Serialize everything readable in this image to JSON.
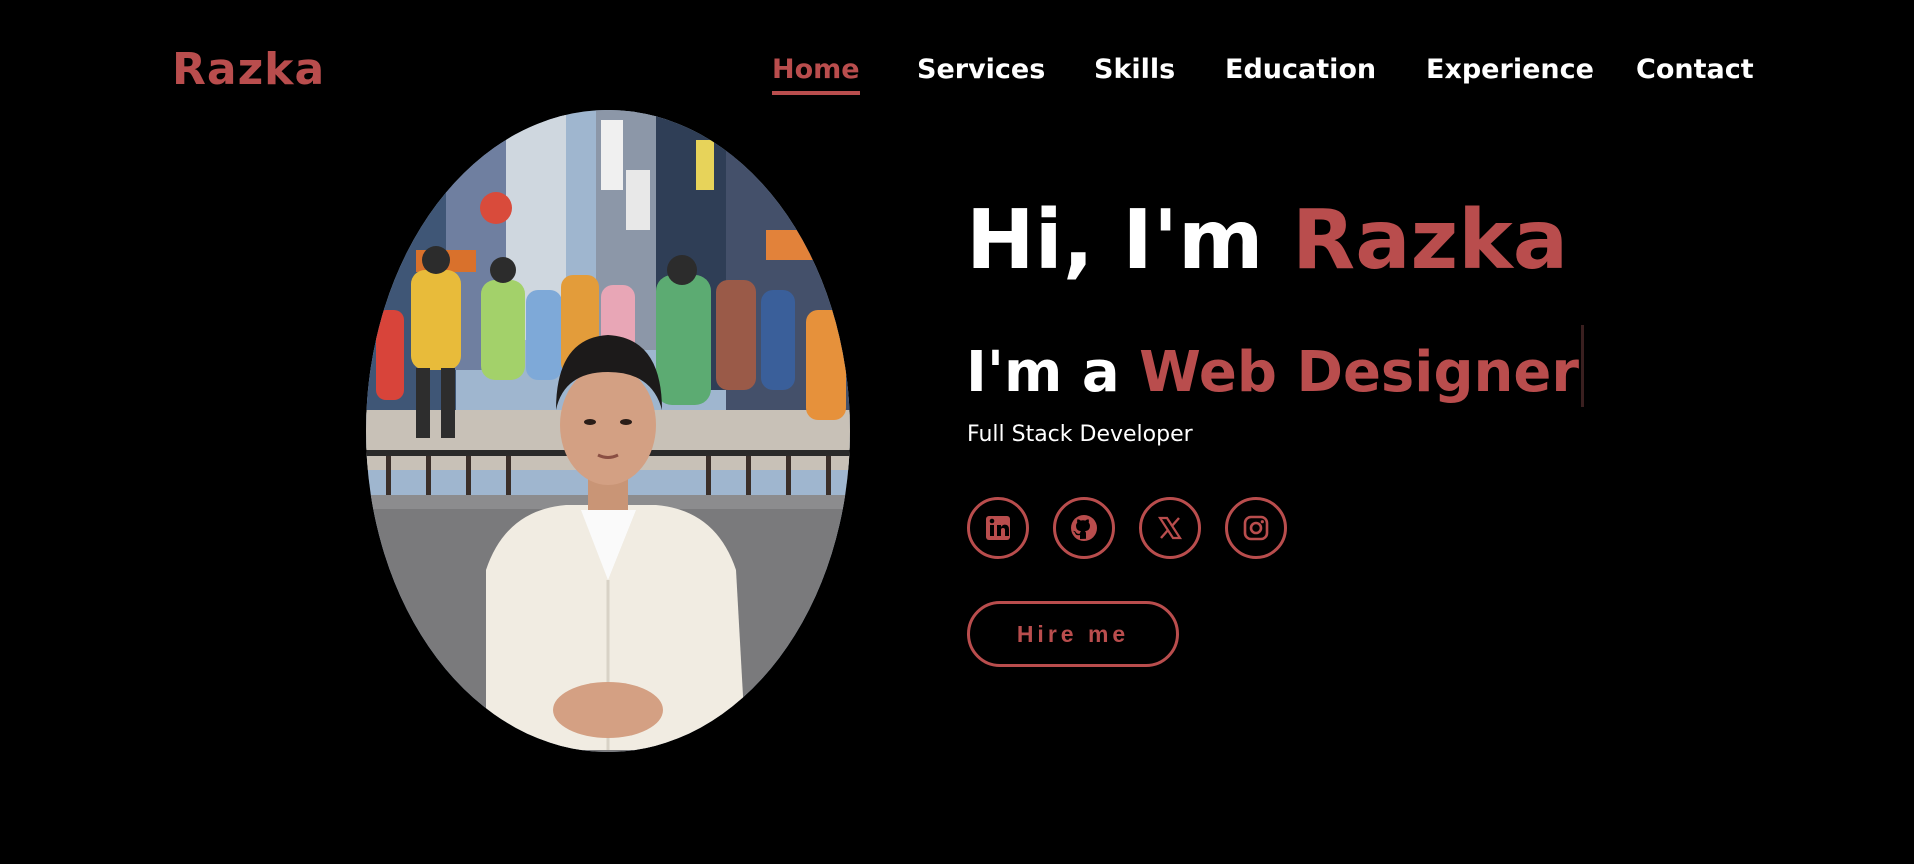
{
  "brand": {
    "name": "Razka",
    "accent_color": "#b94d4d",
    "background": "#000000"
  },
  "nav": {
    "items": [
      {
        "label": "Home",
        "active": true
      },
      {
        "label": "Services",
        "active": false
      },
      {
        "label": "Skills",
        "active": false
      },
      {
        "label": "Education",
        "active": false
      },
      {
        "label": "Experience",
        "active": false
      },
      {
        "label": "Contact",
        "active": false
      }
    ]
  },
  "hero": {
    "greeting": "Hi, I'm ",
    "name": "Razka",
    "role_prefix": "I'm a ",
    "role": "Web Designer",
    "tagline": "Full Stack Developer",
    "portrait": "profile-photo"
  },
  "socials": [
    {
      "name": "linkedin-icon"
    },
    {
      "name": "github-icon"
    },
    {
      "name": "x-icon"
    },
    {
      "name": "instagram-icon"
    }
  ],
  "cta": {
    "hire_label": "Hire me"
  }
}
